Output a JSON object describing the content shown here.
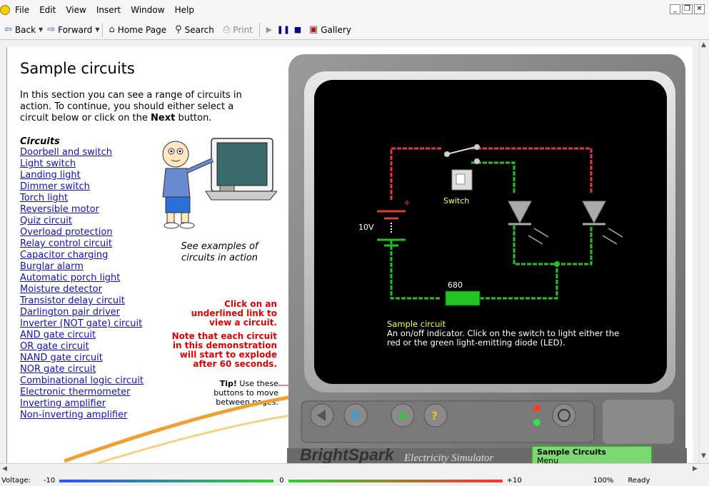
{
  "menu": [
    "File",
    "Edit",
    "View",
    "Insert",
    "Window",
    "Help"
  ],
  "toolbar": {
    "back": "Back",
    "forward": "Forward",
    "home": "Home Page",
    "search": "Search",
    "print": "Print",
    "gallery": "Gallery"
  },
  "page": {
    "title": "Sample circuits",
    "intro_a": "In this section you can see a range of circuits in action. To continue, you should either select a circuit below or click on the ",
    "intro_next": "Next",
    "intro_b": " button.",
    "circuits_heading": "Circuits",
    "circuits": [
      "Doorbell and switch",
      "Light switch",
      "Landing light",
      "Dimmer switch",
      "Torch light",
      "Reversible motor",
      "Quiz circuit",
      "Overload protection",
      "Relay control circuit",
      "Capacitor charging",
      "Burglar alarm",
      "Automatic porch light",
      "Moisture detector",
      "Transistor delay circuit",
      "Darlington pair driver",
      "Inverter (NOT gate) circuit",
      "AND gate circuit",
      "OR gate circuit",
      "NAND gate circuit",
      "NOR gate circuit",
      "Combinational logic circuit",
      "Electronic thermometer",
      "Inverting amplifier",
      "Non-inverting amplifier"
    ],
    "caption": "See examples of circuits in action",
    "red_note_1": "Click on an underlined link to view a circuit.",
    "red_note_2": "Note that each circuit in this demonstration will start to explode after 60 seconds.",
    "tip_bold": "Tip!",
    "tip_text": " Use these buttons to move between pages."
  },
  "simulator": {
    "voltage_label": "10V",
    "resistor_label": "680",
    "switch_label": "Switch",
    "info_title": "Sample circuit",
    "info_text": "An on/off indicator. Click on the switch to light either the red or the green light-emitting diode (LED).",
    "brand": "BrightSpark",
    "brand_sub": "Electricity Simulator",
    "lcd_title": "Sample Circuits",
    "lcd_sub": "Menu"
  },
  "status": {
    "voltage_label": "Voltage:",
    "v_min": "-10",
    "v_zero": "0",
    "v_max": "+10",
    "zoom": "100%",
    "state": "Ready"
  },
  "colors": {
    "link": "#1010c0",
    "warning": "#e00000",
    "wire_red": "#e03a3a",
    "wire_green": "#22c422",
    "screen": "#000000"
  }
}
